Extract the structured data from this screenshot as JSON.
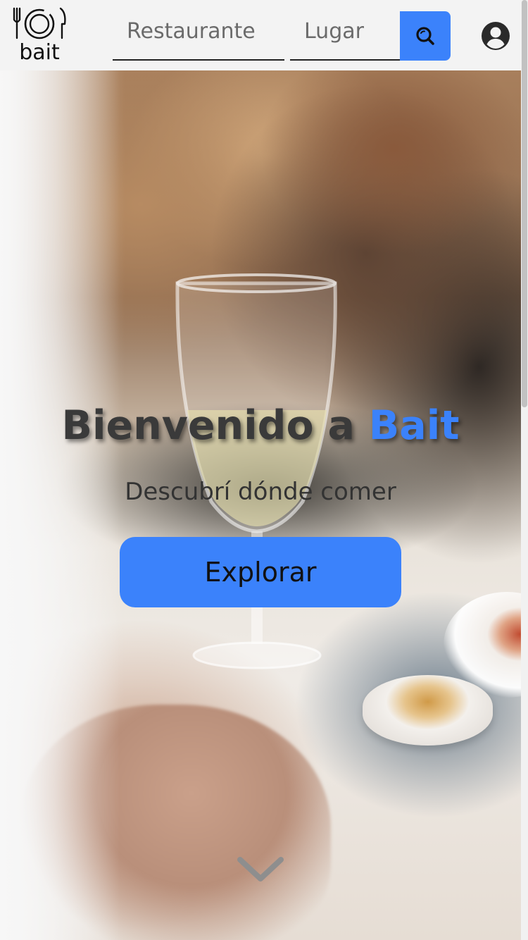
{
  "brand": {
    "logo_text": "bait",
    "logo_icon": "fork-plate-knife-icon"
  },
  "search": {
    "restaurant_placeholder": "Restaurante",
    "place_placeholder": "Lugar",
    "button_icon": "search-icon"
  },
  "account": {
    "icon": "user-circle-icon"
  },
  "hero": {
    "title_prefix": "Bienvenido a ",
    "title_brand": "Bait",
    "subtitle": "Descubrí dónde comer",
    "cta_label": "Explorar",
    "scroll_icon": "chevron-down-icon"
  },
  "colors": {
    "accent": "#3b82fb",
    "header_bg": "#f3f3f3",
    "title_text": "#3a3a3a"
  }
}
